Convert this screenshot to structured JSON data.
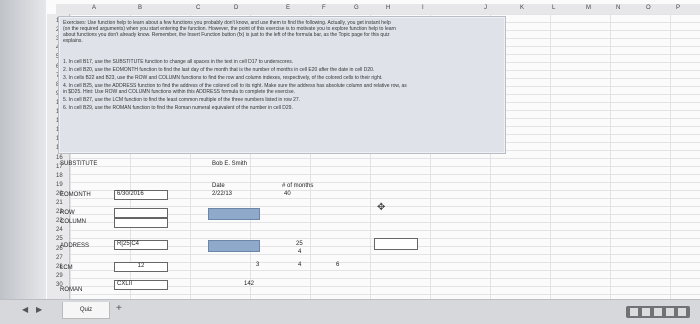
{
  "columns": [
    "A",
    "B",
    "C",
    "D",
    "E",
    "F",
    "G",
    "H",
    "I",
    "J",
    "K",
    "L",
    "M",
    "N",
    "O",
    "P"
  ],
  "rows": [
    "1",
    "2",
    "3",
    "4",
    "5",
    "6",
    "7",
    "8",
    "9",
    "10",
    "11",
    "12",
    "13",
    "14",
    "15",
    "16",
    "17",
    "18",
    "19",
    "20",
    "21",
    "22",
    "23",
    "24",
    "25",
    "26",
    "27",
    "28",
    "29",
    "30"
  ],
  "textbox": {
    "intro_1": "Exercises: Use function help to learn about a few functions you probably don't know, and use them to find the following. Actually, you get instant help",
    "intro_2": "(on the required arguments) when you start entering the function. However, the point of this exercise is to motivate you to explore function help to learn",
    "intro_3": "about functions you don't already know. Remember, the Insert Function button (fx) is just to the left of the formula bar, as the Topic page for this quiz",
    "intro_4": "explains.",
    "items": [
      "1. In cell B17, use the SUBSTITUTE function to change all spaces in the text in cell D17 to underscores.",
      "2. In cell B20, use the EOMONTH function to find the last day of the month that is the number of months in cell E20 after the date in cell D20.",
      "3. In cells B22 and B23, use the ROW and COLUMN functions to find the row and column indexes, respectively, of the colored cells to their right.",
      "4. In cell B25, use the ADDRESS function to find the address of the colored cell to its right. Make sure the address has absolute column and relative row, as",
      "in $D25. Hint: Use ROW and COLUMN functions within this ADDRESS formula to complete the exercise.",
      "5. In cell B27, use the LCM function to find the least common multiple of the three numbers listed in row 27.",
      "6. In cell B29, use the ROMAN function to find the Roman numeral equivalent of the number in cell D29."
    ]
  },
  "cells": {
    "a17": "SUBSTITUTE",
    "d17": "Bob E. Smith",
    "a20": "EOMONTH",
    "b20": "6/30/2016",
    "d19": "Date",
    "d20": "2/22/13",
    "e19": "# of months",
    "e20": "40",
    "a22": "ROW",
    "a23": "COLUMN",
    "a25": "ADDRESS",
    "b25": "R[25]C4",
    "e25": "25",
    "e26": "4",
    "e27": "4",
    "a27": "LCM",
    "b27": "12",
    "d27": "3",
    "f27": "6",
    "a29": "ROMAN",
    "b29": "CXLII",
    "d29": "142"
  },
  "tabs": {
    "sheet_name": "Quiz",
    "add_label": "+"
  },
  "icons": {
    "nav_prev": "◀",
    "nav_next": "▶",
    "cursor": "✥"
  },
  "colors": {
    "highlight": "#8ea9c9",
    "textbox_bg": "#dfe3e9"
  }
}
